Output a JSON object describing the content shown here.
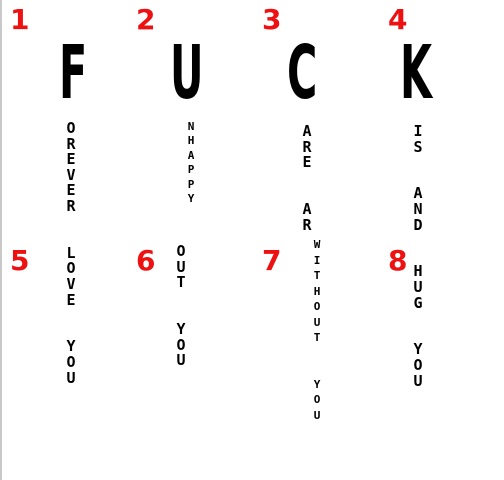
{
  "numbers": [
    "1",
    "2",
    "3",
    "4",
    "5",
    "6",
    "7",
    "8"
  ],
  "big_letters": [
    "F",
    "U",
    "C",
    "K"
  ],
  "columns": {
    "col1": "OREVER  LOVE  YOU",
    "col2_top": "NHAPPY",
    "col2_bottom": "OUT  YOU",
    "col3_top": "ARE  AR",
    "col3_bottom": "WITHOUT  YOU",
    "col4": "IS  AND  HUG  YOU"
  },
  "colors": {
    "number_red": "#ee1111",
    "text": "#000000",
    "background": "#ffffff"
  }
}
